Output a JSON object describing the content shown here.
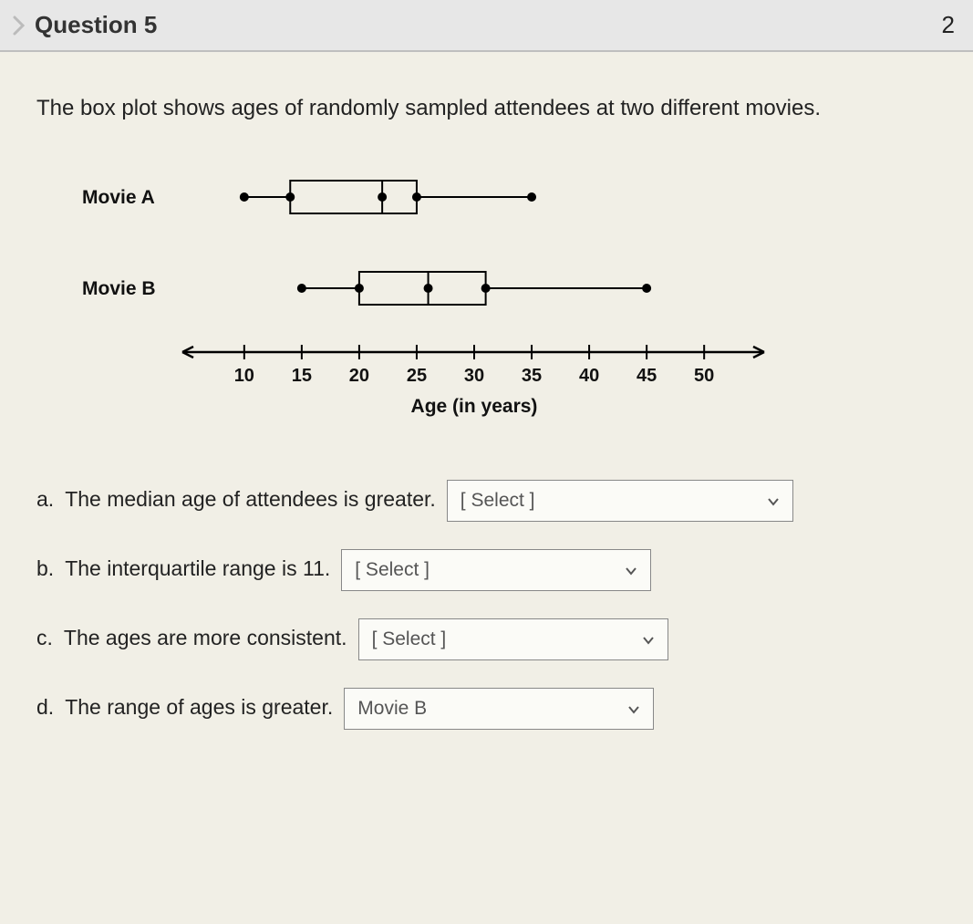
{
  "header": {
    "question_label": "Question 5",
    "points_fragment": "2"
  },
  "prompt": "The box plot shows ages of randomly sampled attendees at two different movies.",
  "chart_data": {
    "type": "boxplot",
    "xlabel": "Age (in years)",
    "xlim": [
      7,
      53
    ],
    "ticks": [
      10,
      15,
      20,
      25,
      30,
      35,
      40,
      45,
      50
    ],
    "series": [
      {
        "name": "Movie A",
        "min": 10,
        "q1": 14,
        "median": 22,
        "q3": 25,
        "max": 35
      },
      {
        "name": "Movie B",
        "min": 15,
        "q1": 20,
        "median": 26,
        "q3": 31,
        "max": 45
      }
    ]
  },
  "questions": {
    "a": {
      "letter": "a.",
      "text": "The median age of attendees is greater.",
      "value": "[ Select ]"
    },
    "b": {
      "letter": "b.",
      "text": "The interquartile range is 11.",
      "value": "[ Select ]"
    },
    "c": {
      "letter": "c.",
      "text": "The ages are more consistent.",
      "value": "[ Select ]"
    },
    "d": {
      "letter": "d.",
      "text": "The range of ages is greater.",
      "value": "Movie B"
    }
  }
}
